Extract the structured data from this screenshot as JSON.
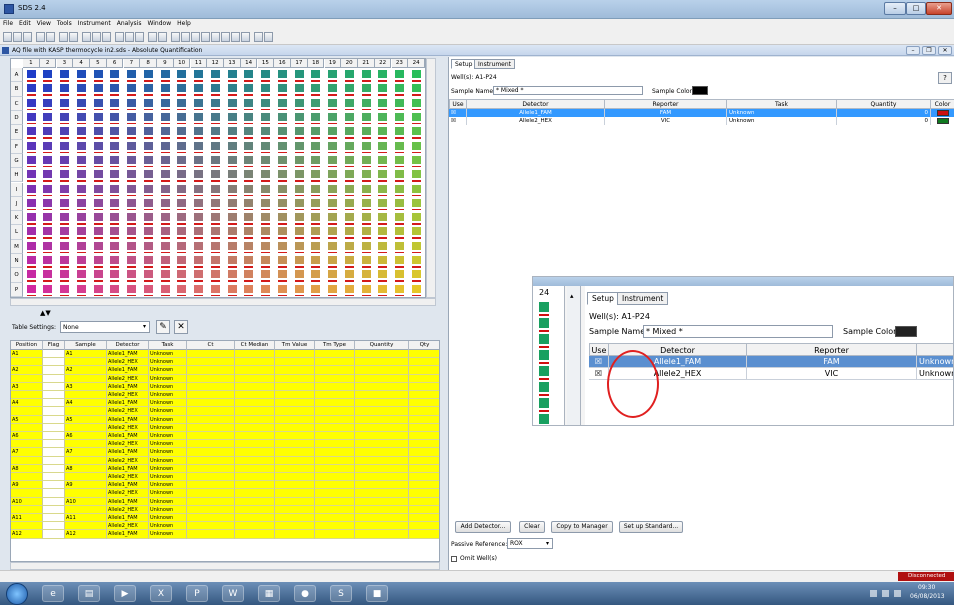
{
  "window": {
    "title": "SDS 2.4",
    "min": "–",
    "max": "□",
    "close": "✕"
  },
  "menu": [
    "File",
    "Edit",
    "View",
    "Tools",
    "Instrument",
    "Analysis",
    "Window",
    "Help"
  ],
  "document": {
    "title": "AQ file with KASP thermocycle in2.sds - Absolute Quantification"
  },
  "plate": {
    "columns": [
      "1",
      "2",
      "3",
      "4",
      "5",
      "6",
      "7",
      "8",
      "9",
      "10",
      "11",
      "12",
      "13",
      "14",
      "15",
      "16",
      "17",
      "18",
      "19",
      "20",
      "21",
      "22",
      "23",
      "24"
    ],
    "rows": [
      "A",
      "B",
      "C",
      "D",
      "E",
      "F",
      "G",
      "H",
      "I",
      "J",
      "K",
      "L",
      "M",
      "N",
      "O",
      "P"
    ]
  },
  "table_settings": {
    "label": "Table Settings:",
    "value": "None"
  },
  "results": {
    "headers": [
      "Position",
      "Flag",
      "Sample",
      "Detector",
      "Task",
      "Ct",
      "Ct Median",
      "Tm Value",
      "Tm Type",
      "Quantity",
      "Qty"
    ],
    "rows": [
      [
        "A1",
        "",
        "A1",
        "Allele1_FAM",
        "Unknown"
      ],
      [
        "",
        "",
        "",
        "Allele2_HEX",
        "Unknown"
      ],
      [
        "A2",
        "",
        "A2",
        "Allele1_FAM",
        "Unknown"
      ],
      [
        "",
        "",
        "",
        "Allele2_HEX",
        "Unknown"
      ],
      [
        "A3",
        "",
        "A3",
        "Allele1_FAM",
        "Unknown"
      ],
      [
        "",
        "",
        "",
        "Allele2_HEX",
        "Unknown"
      ],
      [
        "A4",
        "",
        "A4",
        "Allele1_FAM",
        "Unknown"
      ],
      [
        "",
        "",
        "",
        "Allele2_HEX",
        "Unknown"
      ],
      [
        "A5",
        "",
        "A5",
        "Allele1_FAM",
        "Unknown"
      ],
      [
        "",
        "",
        "",
        "Allele2_HEX",
        "Unknown"
      ],
      [
        "A6",
        "",
        "A6",
        "Allele1_FAM",
        "Unknown"
      ],
      [
        "",
        "",
        "",
        "Allele2_HEX",
        "Unknown"
      ],
      [
        "A7",
        "",
        "A7",
        "Allele1_FAM",
        "Unknown"
      ],
      [
        "",
        "",
        "",
        "Allele2_HEX",
        "Unknown"
      ],
      [
        "A8",
        "",
        "A8",
        "Allele1_FAM",
        "Unknown"
      ],
      [
        "",
        "",
        "",
        "Allele2_HEX",
        "Unknown"
      ],
      [
        "A9",
        "",
        "A9",
        "Allele1_FAM",
        "Unknown"
      ],
      [
        "",
        "",
        "",
        "Allele2_HEX",
        "Unknown"
      ],
      [
        "A10",
        "",
        "A10",
        "Allele1_FAM",
        "Unknown"
      ],
      [
        "",
        "",
        "",
        "Allele2_HEX",
        "Unknown"
      ],
      [
        "A11",
        "",
        "A11",
        "Allele1_FAM",
        "Unknown"
      ],
      [
        "",
        "",
        "",
        "Allele2_HEX",
        "Unknown"
      ],
      [
        "A12",
        "",
        "A12",
        "Allele1_FAM",
        "Unknown"
      ]
    ]
  },
  "setup": {
    "tabs": [
      "Setup",
      "Instrument"
    ],
    "wells": "Well(s): A1-P24",
    "sample_name_label": "Sample Name:",
    "sample_name": "* Mixed *",
    "sample_color_label": "Sample Color:",
    "help": "?",
    "detector_headers": [
      "Use",
      "Detector",
      "Reporter",
      "Task",
      "Quantity",
      "Color"
    ],
    "detectors": [
      {
        "use": "☒",
        "name": "Allele1_FAM",
        "reporter": "FAM",
        "task": "Unknown",
        "quantity": "0",
        "color": "#cc1010",
        "selected": true
      },
      {
        "use": "☒",
        "name": "Allele2_HEX",
        "reporter": "VIC",
        "task": "Unknown",
        "quantity": "0",
        "color": "#107a20",
        "selected": false
      }
    ],
    "buttons": [
      "Add Detector...",
      "Clear",
      "Copy to Manager",
      "Set up Standard..."
    ],
    "passive_label": "Passive Reference:",
    "passive_value": "ROX",
    "omit_label": "Omit Well(s)"
  },
  "zoom": {
    "col_label": "24"
  },
  "status": {
    "connection": "Disconnected"
  },
  "taskbar": {
    "time": "09:30",
    "date": "06/08/2013"
  },
  "colors": {
    "selection": "#3399ff",
    "results_bg": "#ffff00",
    "alert_circle": "#e02020"
  }
}
